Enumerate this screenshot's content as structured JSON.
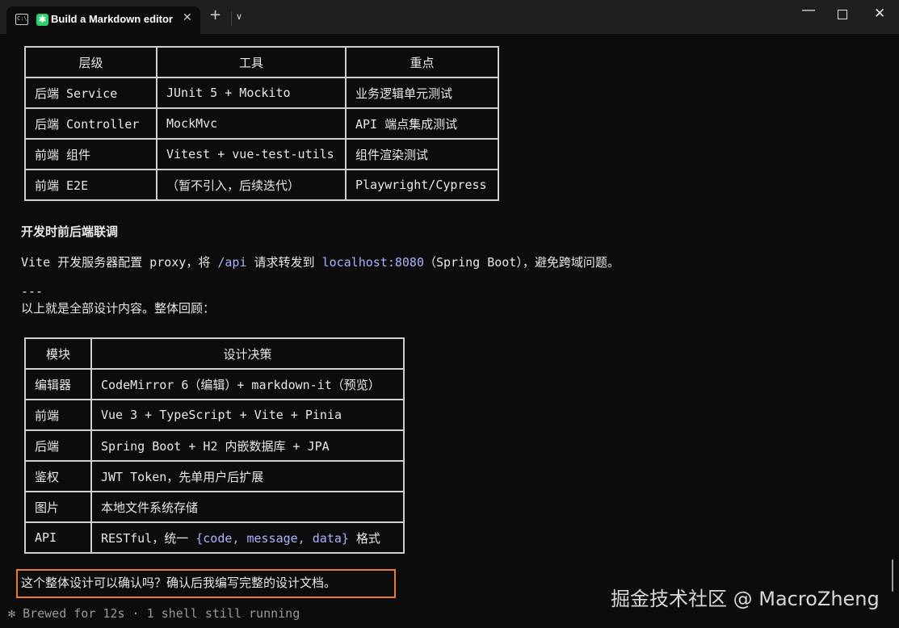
{
  "window": {
    "tab_title": "Build a Markdown editor",
    "terminal_icon_text": "C:\\",
    "app_icon_glyph": "✱",
    "close_glyph": "✕",
    "new_tab_glyph": "+",
    "dropdown_glyph": "∨",
    "minimize_glyph": "—",
    "window_close_glyph": "✕"
  },
  "testing_table": {
    "headers": [
      "层级",
      "工具",
      "重点"
    ],
    "rows": [
      [
        "后端 Service",
        "JUnit 5 + Mockito",
        "业务逻辑单元测试"
      ],
      [
        "后端 Controller",
        "MockMvc",
        "API 端点集成测试"
      ],
      [
        "前端 组件",
        "Vitest + vue-test-utils",
        "组件渲染测试"
      ],
      [
        "前端 E2E",
        "（暂不引入，后续迭代）",
        "Playwright/Cypress"
      ]
    ]
  },
  "dev_section": {
    "heading": "开发时前后端联调",
    "text_1": "Vite 开发服务器配置 proxy，将 ",
    "code_1": "/api",
    "text_2": " 请求转发到 ",
    "code_2": "localhost:8080",
    "text_3": "（Spring Boot），避免跨域问题。"
  },
  "divider": "---",
  "summary_intro": "以上就是全部设计内容。整体回顾：",
  "summary_table": {
    "headers": [
      "模块",
      "设计决策"
    ],
    "rows": [
      [
        "编辑器",
        "CodeMirror 6（编辑）+ markdown-it（预览）"
      ],
      [
        "前端",
        "Vue 3 + TypeScript + Vite + Pinia"
      ],
      [
        "后端",
        "Spring Boot + H2 内嵌数据库 + JPA"
      ],
      [
        "鉴权",
        "JWT Token，先单用户后扩展"
      ],
      [
        "图片",
        "本地文件系统存储"
      ]
    ],
    "api_row": {
      "label": "API",
      "text_1": "RESTful，统一 ",
      "code": "{code, message, data}",
      "text_2": " 格式"
    }
  },
  "prompt_question": "这个整体设计可以确认吗？确认后我编写完整的设计文档。",
  "status": {
    "glyph": "✻",
    "text": "Brewed for 12s · 1 shell still running"
  },
  "watermark": "掘金技术社区 @ MacroZheng",
  "colors": {
    "background": "#0c0c0c",
    "code": "#a8b4ff",
    "prompt_border": "#e87c2e",
    "app_icon": "#2bd16f"
  }
}
